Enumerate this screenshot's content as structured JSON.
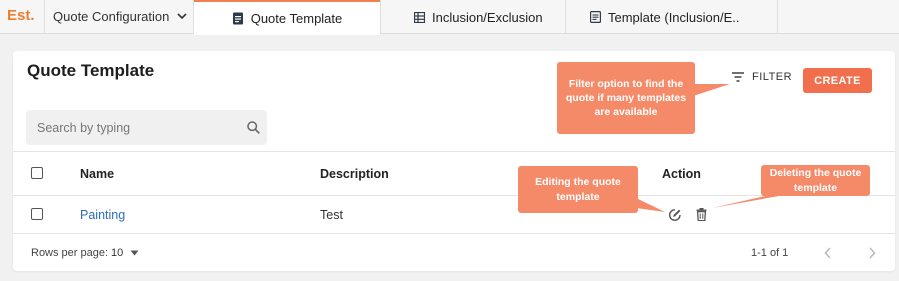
{
  "app": {
    "logo": "Est."
  },
  "nav": {
    "dropdown_label": "Quote Configuration",
    "tabs": [
      {
        "label": "Quote Template",
        "icon": "document-icon",
        "active": true
      },
      {
        "label": "Inclusion/Exclusion",
        "icon": "table-icon",
        "active": false
      },
      {
        "label": "Template (Inclusion/E..",
        "icon": "list-icon",
        "active": false
      }
    ]
  },
  "page": {
    "title": "Quote Template",
    "filter_label": "FILTER",
    "create_label": "CREATE",
    "search_placeholder": "Search by typing"
  },
  "table": {
    "columns": [
      "Name",
      "Description",
      "Action"
    ],
    "rows": [
      {
        "name": "Painting",
        "description": "Test"
      }
    ]
  },
  "pagination": {
    "rows_per_page_label": "Rows per page:",
    "rows_per_page_value": "10",
    "range": "1-1 of 1"
  },
  "annotations": {
    "filter": "Filter option to find the quote if many templates are available",
    "edit": "Editing the quote template",
    "delete": "Deleting the quote template"
  },
  "colors": {
    "brand": "#e8802f",
    "accent": "#f26f4d",
    "callout": "#f58a69",
    "link": "#2a6ebb"
  }
}
